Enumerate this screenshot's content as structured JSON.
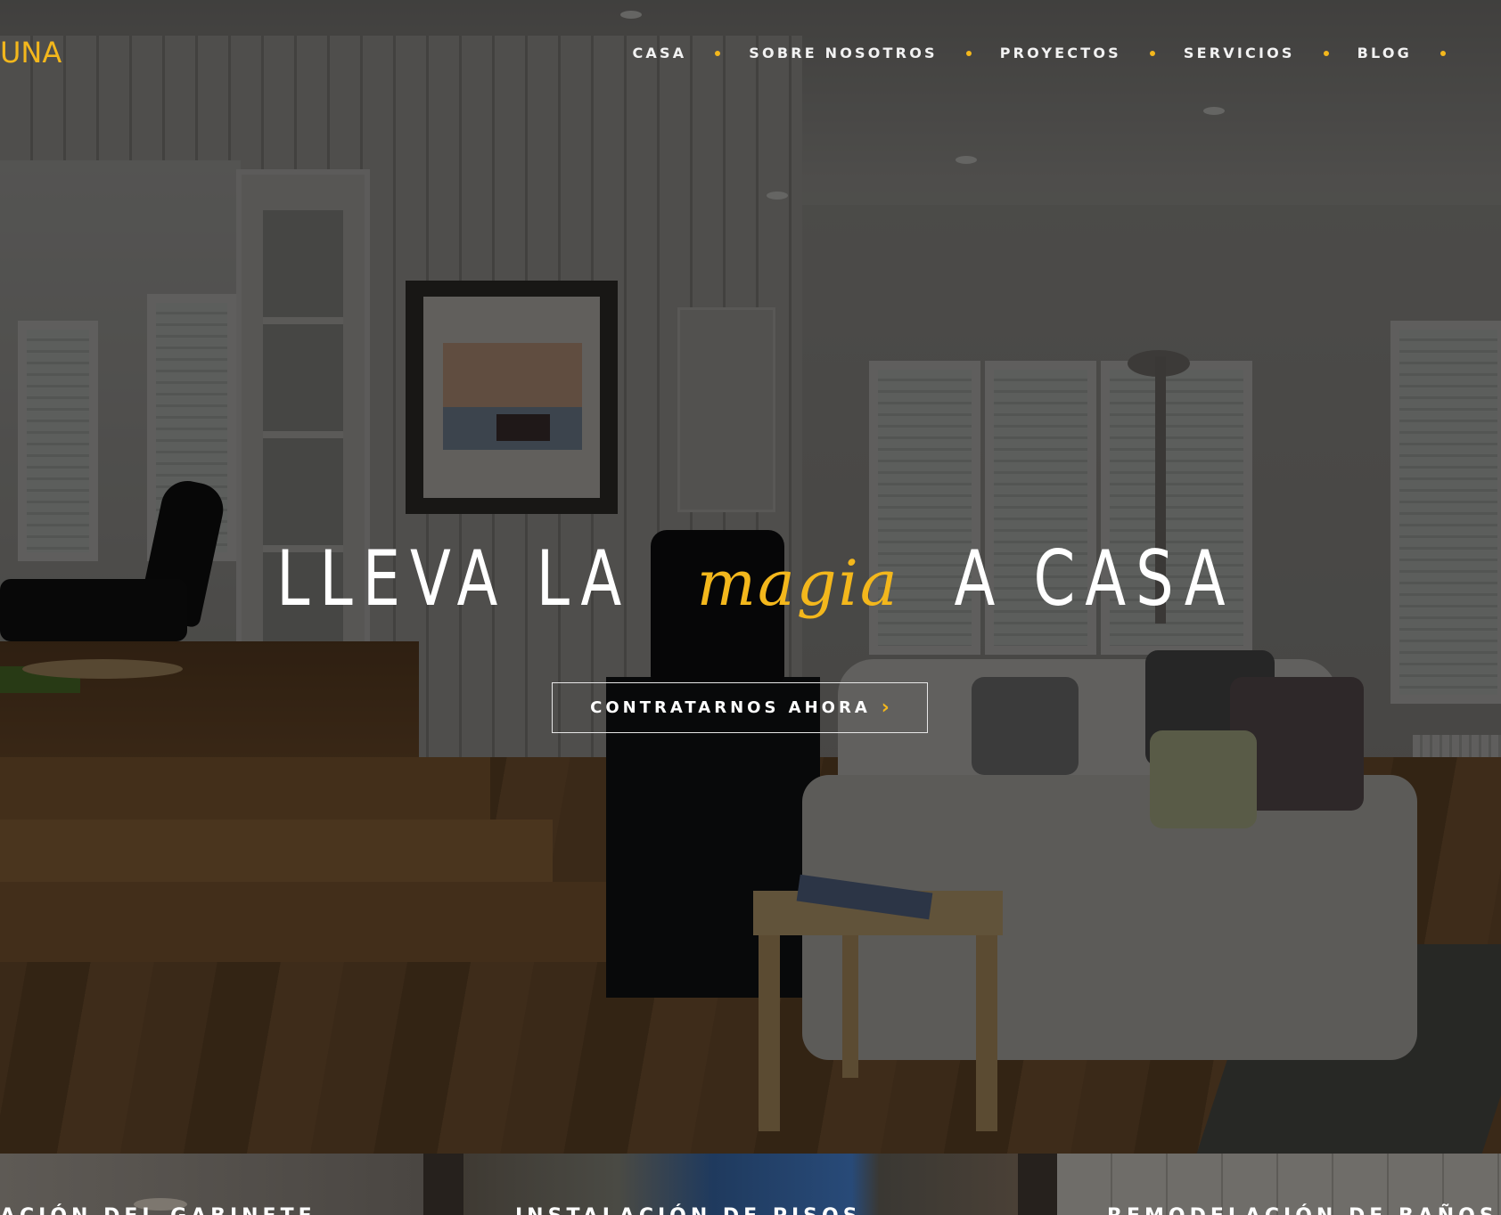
{
  "header": {
    "logo_text": "UNA",
    "nav": [
      {
        "label": "CASA"
      },
      {
        "label": "SOBRE NOSOTROS"
      },
      {
        "label": "PROYECTOS"
      },
      {
        "label": "SERVICIOS"
      },
      {
        "label": "BLOG"
      }
    ]
  },
  "hero": {
    "headline_before": "LLEVA LA",
    "headline_accent": "magia",
    "headline_after": "A CASA",
    "cta_label": "CONTRATARNOS AHORA",
    "cta_icon": "chevron-right-icon",
    "background": "living-room-photo"
  },
  "services": [
    {
      "title": "ACIÓN DEL GABINETE"
    },
    {
      "title": "INSTALACIÓN DE PISOS"
    },
    {
      "title": "REMODELACIÓN DE BAÑOS"
    }
  ],
  "colors": {
    "accent": "#f3b71c",
    "text": "#ffffff",
    "overlay": "rgba(0,0,0,0.58)"
  }
}
